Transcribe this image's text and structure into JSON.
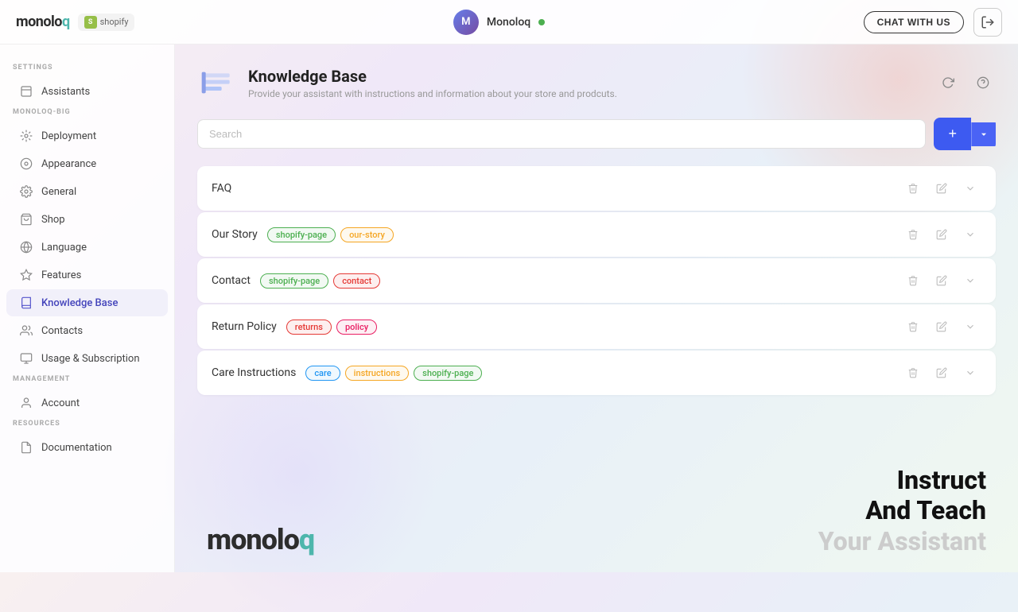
{
  "header": {
    "logo_text": "monoloq",
    "shopify_label": "shopify",
    "user_name": "Monoloq",
    "chat_btn_label": "CHAT WITH US",
    "logout_icon": "→"
  },
  "sidebar": {
    "settings_label": "SETTINGS",
    "settings_items": [
      {
        "id": "assistants",
        "label": "Assistants",
        "icon": "📄"
      }
    ],
    "monoloq_big_label": "MONOLOQ-BIG",
    "monoloq_big_items": [
      {
        "id": "deployment",
        "label": "Deployment",
        "icon": "🚀"
      },
      {
        "id": "appearance",
        "label": "Appearance",
        "icon": "🎨"
      },
      {
        "id": "general",
        "label": "General",
        "icon": "⚙️"
      },
      {
        "id": "shop",
        "label": "Shop",
        "icon": "🛍️"
      },
      {
        "id": "language",
        "label": "Language",
        "icon": "🌐"
      },
      {
        "id": "features",
        "label": "Features",
        "icon": "✨"
      },
      {
        "id": "knowledge-base",
        "label": "Knowledge Base",
        "icon": "📚",
        "active": true
      }
    ],
    "management_label": "MANAGEMENT",
    "management_items": [
      {
        "id": "contacts",
        "label": "Contacts",
        "icon": "👥"
      },
      {
        "id": "usage",
        "label": "Usage & Subscription",
        "icon": "📊"
      },
      {
        "id": "account",
        "label": "Account",
        "icon": "👤"
      }
    ],
    "resources_label": "RESOURCES",
    "resources_items": [
      {
        "id": "documentation",
        "label": "Documentation",
        "icon": "📖"
      }
    ]
  },
  "knowledge_base": {
    "title": "Knowledge Base",
    "subtitle": "Provide your assistant with instructions and information about your store and prodcuts.",
    "search_placeholder": "Search",
    "add_btn_label": "+",
    "items": [
      {
        "id": "faq",
        "name": "FAQ",
        "tags": []
      },
      {
        "id": "our-story",
        "name": "Our Story",
        "tags": [
          {
            "label": "shopify-page",
            "style": "green"
          },
          {
            "label": "our-story",
            "style": "yellow"
          }
        ]
      },
      {
        "id": "contact",
        "name": "Contact",
        "tags": [
          {
            "label": "shopify-page",
            "style": "green"
          },
          {
            "label": "contact",
            "style": "red"
          }
        ]
      },
      {
        "id": "return-policy",
        "name": "Return Policy",
        "tags": [
          {
            "label": "returns",
            "style": "red"
          },
          {
            "label": "policy",
            "style": "pink"
          }
        ]
      },
      {
        "id": "care-instructions",
        "name": "Care Instructions",
        "tags": [
          {
            "label": "care",
            "style": "blue"
          },
          {
            "label": "instructions",
            "style": "yellow"
          },
          {
            "label": "shopify-page",
            "style": "green"
          }
        ]
      }
    ]
  },
  "bottom_branding": {
    "logo": "monoloq",
    "tagline_line1": "Instruct",
    "tagline_line2": "And Teach",
    "tagline_line3": "Your Assistant"
  }
}
